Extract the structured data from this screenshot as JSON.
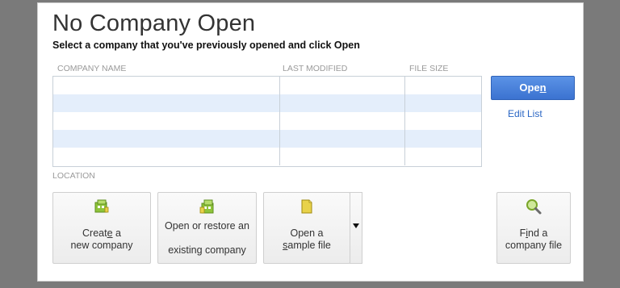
{
  "dialog": {
    "title": "No Company Open",
    "subtitle": "Select a company that you've previously opened and click Open"
  },
  "table": {
    "columns": [
      "COMPANY NAME",
      "LAST MODIFIED",
      "FILE SIZE"
    ],
    "rows": []
  },
  "actions": {
    "open_label_pre": "Ope",
    "open_label_ul": "n",
    "edit_list_label": "Edit List"
  },
  "location": {
    "label": "LOCATION"
  },
  "tiles": {
    "create": {
      "line1_pre": "Creat",
      "line1_ul": "e",
      "line1_post": " a",
      "line2": "new company"
    },
    "restore": {
      "line1": "Open or restore an",
      "line2": "existing company"
    },
    "sample": {
      "line1": "Open a",
      "line2_ul": "s",
      "line2_post": "ample file"
    },
    "find": {
      "line1_pre": "F",
      "line1_ul": "i",
      "line1_post": "nd a",
      "line2": "company file"
    }
  },
  "colors": {
    "accent": "#3b72d0",
    "link": "#2a66c4",
    "row_alt": "#e4eefb",
    "icon_green": "#8fc43a",
    "icon_yellow": "#e8d24a"
  }
}
